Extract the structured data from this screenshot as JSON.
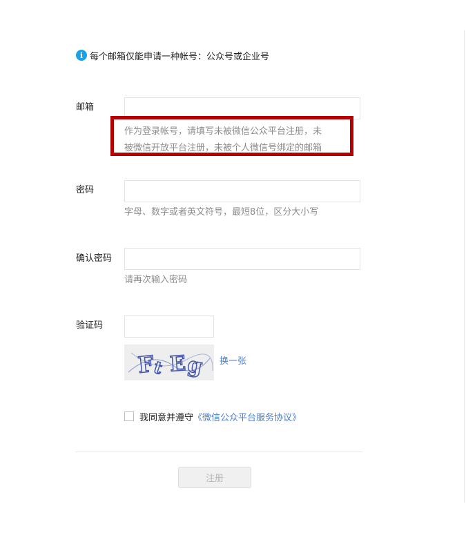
{
  "notice": {
    "icon": "info-icon",
    "text": "每个邮箱仅能申请一种帐号：公众号或企业号"
  },
  "form": {
    "email": {
      "label": "邮箱",
      "value": "",
      "hint_line1": "作为登录帐号，请填写未被微信公众平台注册，未",
      "hint_line2": "被微信开放平台注册，未被个人微信号绑定的邮箱",
      "highlight_color": "#b30000"
    },
    "password": {
      "label": "密码",
      "value": "",
      "hint": "字母、数字或者英文符号，最短8位，区分大小写"
    },
    "confirm_password": {
      "label": "确认密码",
      "value": "",
      "hint": "请再次输入密码"
    },
    "captcha": {
      "label": "验证码",
      "value": "",
      "image_text": "FtEg",
      "refresh_label": "换一张"
    },
    "agreement": {
      "checked": false,
      "prefix": "我同意并遵守",
      "link": "《微信公众平台服务协议》"
    },
    "submit_label": "注册"
  },
  "colors": {
    "link": "#4a7fd1",
    "info_icon": "#1aa1e6",
    "captcha_ink": "#4455aa"
  }
}
